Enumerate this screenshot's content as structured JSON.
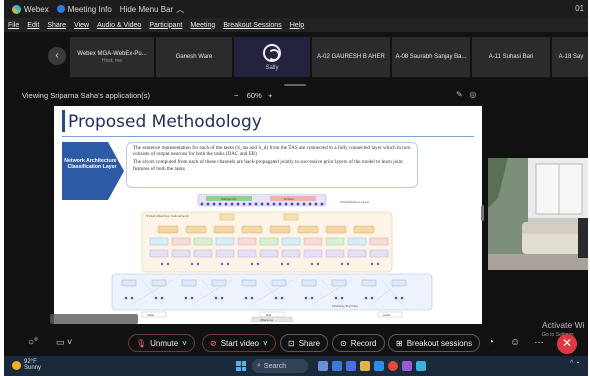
{
  "titlebar": {
    "app_name": "Webex",
    "meeting_info": "Meeting Info",
    "hide_menu": "Hide Menu Bar",
    "hide_menu_icon": "chevron-up-icon",
    "time": "01"
  },
  "menu": [
    "File",
    "Edit",
    "Share",
    "View",
    "Audio & Video",
    "Participant",
    "Meeting",
    "Breakout Sessions",
    "Help"
  ],
  "participants": {
    "prev_icon": "chevron-left-icon",
    "tiles": [
      {
        "name": "Webex MGA-WebEx-Pu...",
        "sub": "Host, me"
      },
      {
        "name": "Ganesh Ware",
        "sub": ""
      },
      {
        "name": "",
        "sub": "Sally",
        "self": true
      },
      {
        "name": "A-02 GAURESH B AHER",
        "sub": ""
      },
      {
        "name": "A-08 Saurabh Sanjay Ba...",
        "sub": ""
      },
      {
        "name": "A-11 Suhasi Bari",
        "sub": ""
      },
      {
        "name": "A-18 Say",
        "sub": ""
      }
    ]
  },
  "viewing": {
    "text": "Viewing Sriparna Saha's application(s)",
    "zoom_minus": "−",
    "zoom": "60%",
    "zoom_plus": "+"
  },
  "slide": {
    "title": "Proposed Methodology",
    "box_label": "Network Architecture : Classification Layer",
    "bullets": [
      "The sentence representation for each of the tasks (S_tas and S_d) from the TAS are connected to a fully connected layer which in turn consists of output neurons for both the tasks (DAC and ER)",
      "The errors computed from each of these channels are back-propagated jointly to successive prior layers of the model to learn joint features of both the tasks"
    ],
    "diagram_labels": {
      "classification": "Classification Layer",
      "encoder": "Triplet Attention Subnetwork",
      "modality": "Modality Encoder",
      "utterance": "Utterance",
      "video": "Video",
      "text": "Text",
      "audio": "Audio",
      "dialogue": "Dialogue Act",
      "emotion": "Emotion"
    }
  },
  "controls": {
    "mute": "Unmute",
    "video": "Start video",
    "share": "Share",
    "record": "Record",
    "breakout": "Breakout sessions",
    "more": "…",
    "end_icon": "close-icon"
  },
  "watermark": {
    "line1": "Activate Wi",
    "line2": "Go to Settings"
  },
  "taskbar": {
    "temp": "92°F",
    "weather": "Sunny",
    "search": "Search"
  }
}
